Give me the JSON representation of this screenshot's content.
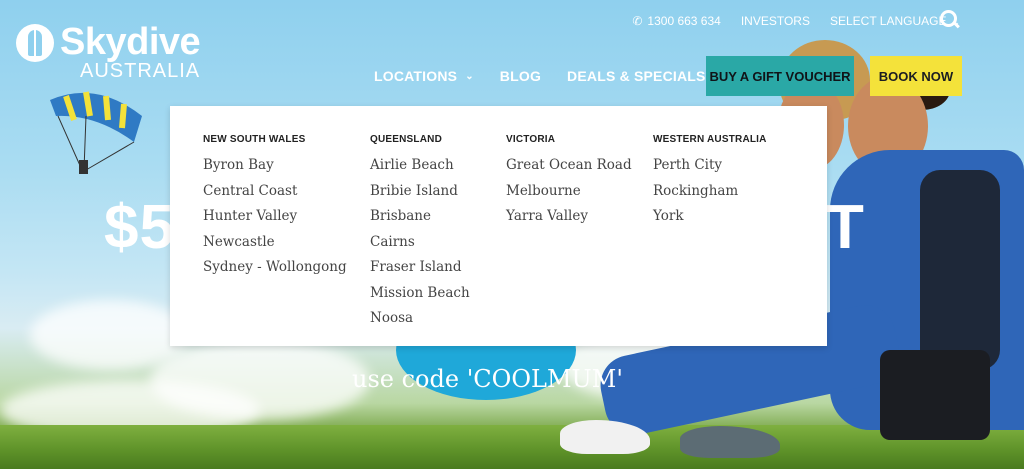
{
  "brand": {
    "name": "Skydive",
    "subtitle": "AUSTRALIA"
  },
  "topbar": {
    "phone": "1300 663 634",
    "investors": "INVESTORS",
    "language": "SELECT LANGUAGE"
  },
  "nav": {
    "locations": "LOCATIONS",
    "blog": "BLOG",
    "deals": "DEALS & SPECIALS"
  },
  "buttons": {
    "gift": "BUY A GIFT VOUCHER",
    "book": "BOOK NOW"
  },
  "hero": {
    "big_left": "$5",
    "big_right": "T",
    "promo": "use code 'COOLMUM'"
  },
  "dropdown": {
    "columns": [
      {
        "title": "NEW SOUTH WALES",
        "items": [
          "Byron Bay",
          "Central Coast",
          "Hunter Valley",
          "Newcastle",
          "Sydney - Wollongong"
        ]
      },
      {
        "title": "QUEENSLAND",
        "items": [
          "Airlie Beach",
          "Bribie Island",
          "Brisbane",
          "Cairns",
          "Fraser Island",
          "Mission Beach",
          "Noosa"
        ]
      },
      {
        "title": "VICTORIA",
        "items": [
          "Great Ocean Road",
          "Melbourne",
          "Yarra Valley"
        ]
      },
      {
        "title": "WESTERN AUSTRALIA",
        "items": [
          "Perth City",
          "Rockingham",
          "York"
        ]
      }
    ]
  },
  "colors": {
    "accent_teal": "#2aa8a6",
    "accent_yellow": "#f4e23a",
    "sky": "#8fd0ee"
  },
  "icons": [
    "phone-icon",
    "chevron-down-icon",
    "search-icon",
    "logo-icon"
  ]
}
